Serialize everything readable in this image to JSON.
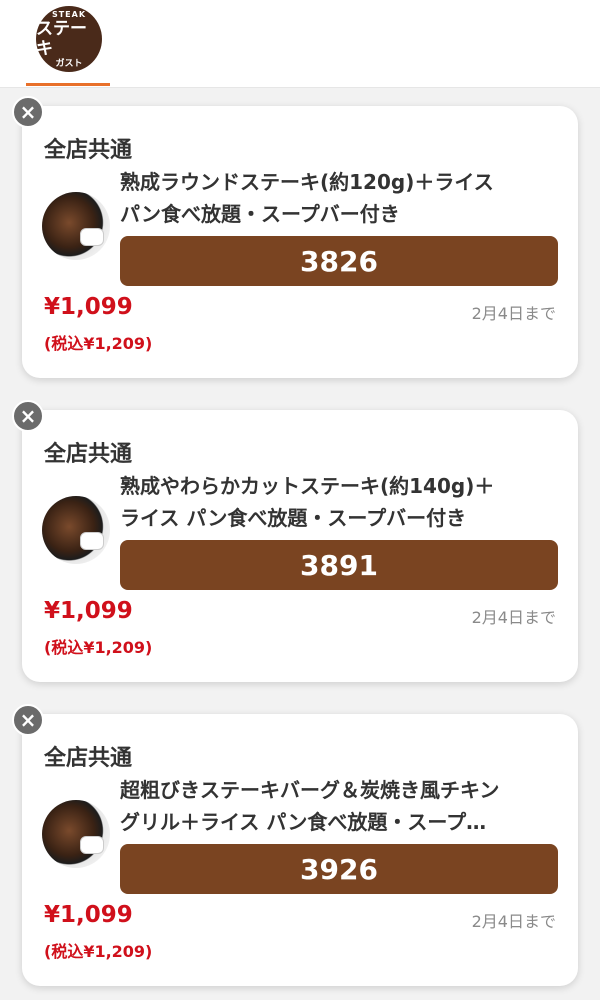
{
  "header": {
    "logo": {
      "line1": "STEAK",
      "line2": "ステーキ",
      "line3": "ガスト"
    },
    "accent_color": "#e8702a"
  },
  "coupons": [
    {
      "scope": "全店共通",
      "title_line1": "熟成ラウンドステーキ(約120g)＋ライス",
      "title_line2": "パン食べ放題・スープバー付き",
      "code": "3826",
      "price": "¥1,099",
      "tax_price": "(税込¥1,209)",
      "valid_until": "2月4日まで"
    },
    {
      "scope": "全店共通",
      "title_line1": "熟成やわらかカットステーキ(約140g)＋",
      "title_line2": "ライス パン食べ放題・スープバー付き",
      "code": "3891",
      "price": "¥1,099",
      "tax_price": "(税込¥1,209)",
      "valid_until": "2月4日まで"
    },
    {
      "scope": "全店共通",
      "title_line1": "超粗びきステーキバーグ＆炭焼き風チキン",
      "title_line2": "グリル＋ライス パン食べ放題・スープ…",
      "code": "3926",
      "price": "¥1,099",
      "tax_price": "(税込¥1,209)",
      "valid_until": "2月4日まで"
    }
  ],
  "colors": {
    "code_box": "#7a4421",
    "price": "#d0101b"
  },
  "icons": {
    "close": "×"
  }
}
